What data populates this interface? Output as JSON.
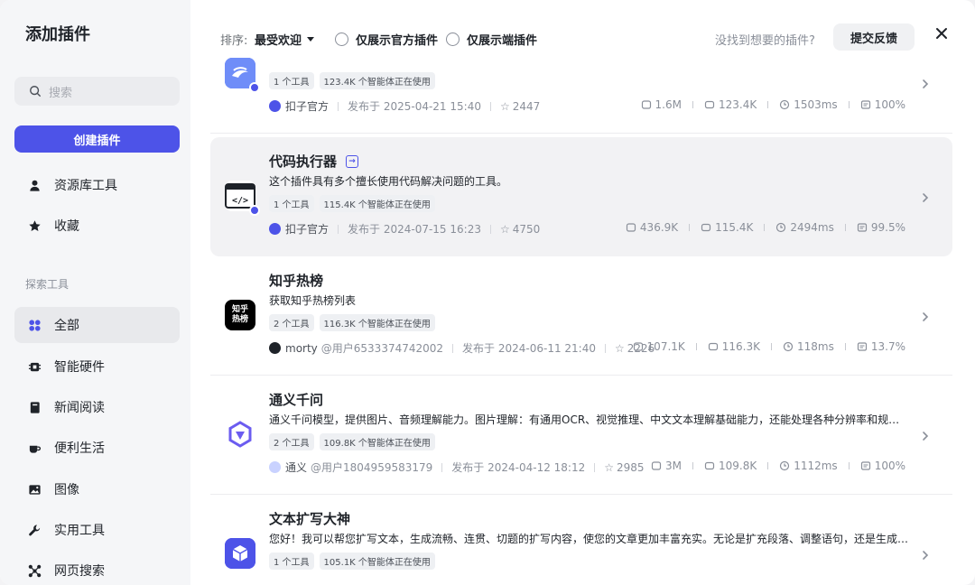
{
  "sidebar": {
    "title": "添加插件",
    "search_placeholder": "搜索",
    "create_label": "创建插件",
    "top_items": [
      {
        "label": "资源库工具",
        "icon": "user-icon"
      },
      {
        "label": "收藏",
        "icon": "star-icon"
      }
    ],
    "section_label": "探索工具",
    "explore_items": [
      {
        "label": "全部",
        "icon": "grid-icon",
        "active": true
      },
      {
        "label": "智能硬件",
        "icon": "chip-icon"
      },
      {
        "label": "新闻阅读",
        "icon": "book-icon"
      },
      {
        "label": "便利生活",
        "icon": "cup-icon"
      },
      {
        "label": "图像",
        "icon": "image-icon"
      },
      {
        "label": "实用工具",
        "icon": "wrench-icon"
      },
      {
        "label": "网页搜索",
        "icon": "network-icon"
      }
    ]
  },
  "topbar": {
    "sort_label": "排序:",
    "sort_value": "最受欢迎",
    "filter_official": "仅展示官方插件",
    "filter_client": "仅展示端插件",
    "hint": "没找到想要的插件?",
    "feedback_label": "提交反馈"
  },
  "plugins": [
    {
      "name": "",
      "desc": "",
      "tags": [
        "1 个工具",
        "123.4K 个智能体正在使用"
      ],
      "author": "扣子官方",
      "author_sub": "",
      "published": "发布于 2025-04-21 15:40",
      "stars": "2447",
      "stats": [
        "1.6M",
        "123.4K",
        "1503ms",
        "100%"
      ],
      "icon_color": "#5b7cf6"
    },
    {
      "name": "代码执行器",
      "desc": "这个插件具有多个擅长使用代码解决问题的工具。",
      "tags": [
        "1 个工具",
        "115.4K 个智能体正在使用"
      ],
      "author": "扣子官方",
      "author_sub": "",
      "published": "发布于 2024-07-15 16:23",
      "stars": "4750",
      "stats": [
        "436.9K",
        "115.4K",
        "2494ms",
        "99.5%"
      ],
      "icon_color": "#ffffff"
    },
    {
      "name": "知乎热榜",
      "desc": "获取知乎热榜列表",
      "tags": [
        "2 个工具",
        "116.3K 个智能体正在使用"
      ],
      "author": "morty",
      "author_sub": "@用户6533374742002",
      "published": "发布于 2024-06-11 21:40",
      "stars": "2226",
      "stats": [
        "107.1K",
        "116.3K",
        "118ms",
        "13.7%"
      ],
      "icon_color": "#000000",
      "icon_text": "知乎热榜"
    },
    {
      "name": "通义千问",
      "desc": "通义千问模型，提供图片、音频理解能力。图片理解：有通用OCR、视觉推理、中文文本理解基础能力，还能处理各种分辨率和规格的图...",
      "tags": [
        "2 个工具",
        "109.8K 个智能体正在使用"
      ],
      "author": "通义",
      "author_sub": "@用户1804959583179",
      "published": "发布于 2024-04-12 18:12",
      "stars": "2985",
      "stats": [
        "3M",
        "109.8K",
        "1112ms",
        "100%"
      ],
      "icon_color": "#ffffff"
    },
    {
      "name": "文本扩写大神",
      "desc": "您好！我可以帮您扩写文本，生成流畅、连贯、切题的扩写内容，使您的文章更加丰富充实。无论是扩充段落、调整语句，还是生成全新...",
      "tags": [
        "1 个工具",
        "105.1K 个智能体正在使用"
      ],
      "author": "",
      "author_sub": "",
      "published": "",
      "stars": "",
      "stats": [],
      "icon_color": "#4d53e8"
    }
  ]
}
